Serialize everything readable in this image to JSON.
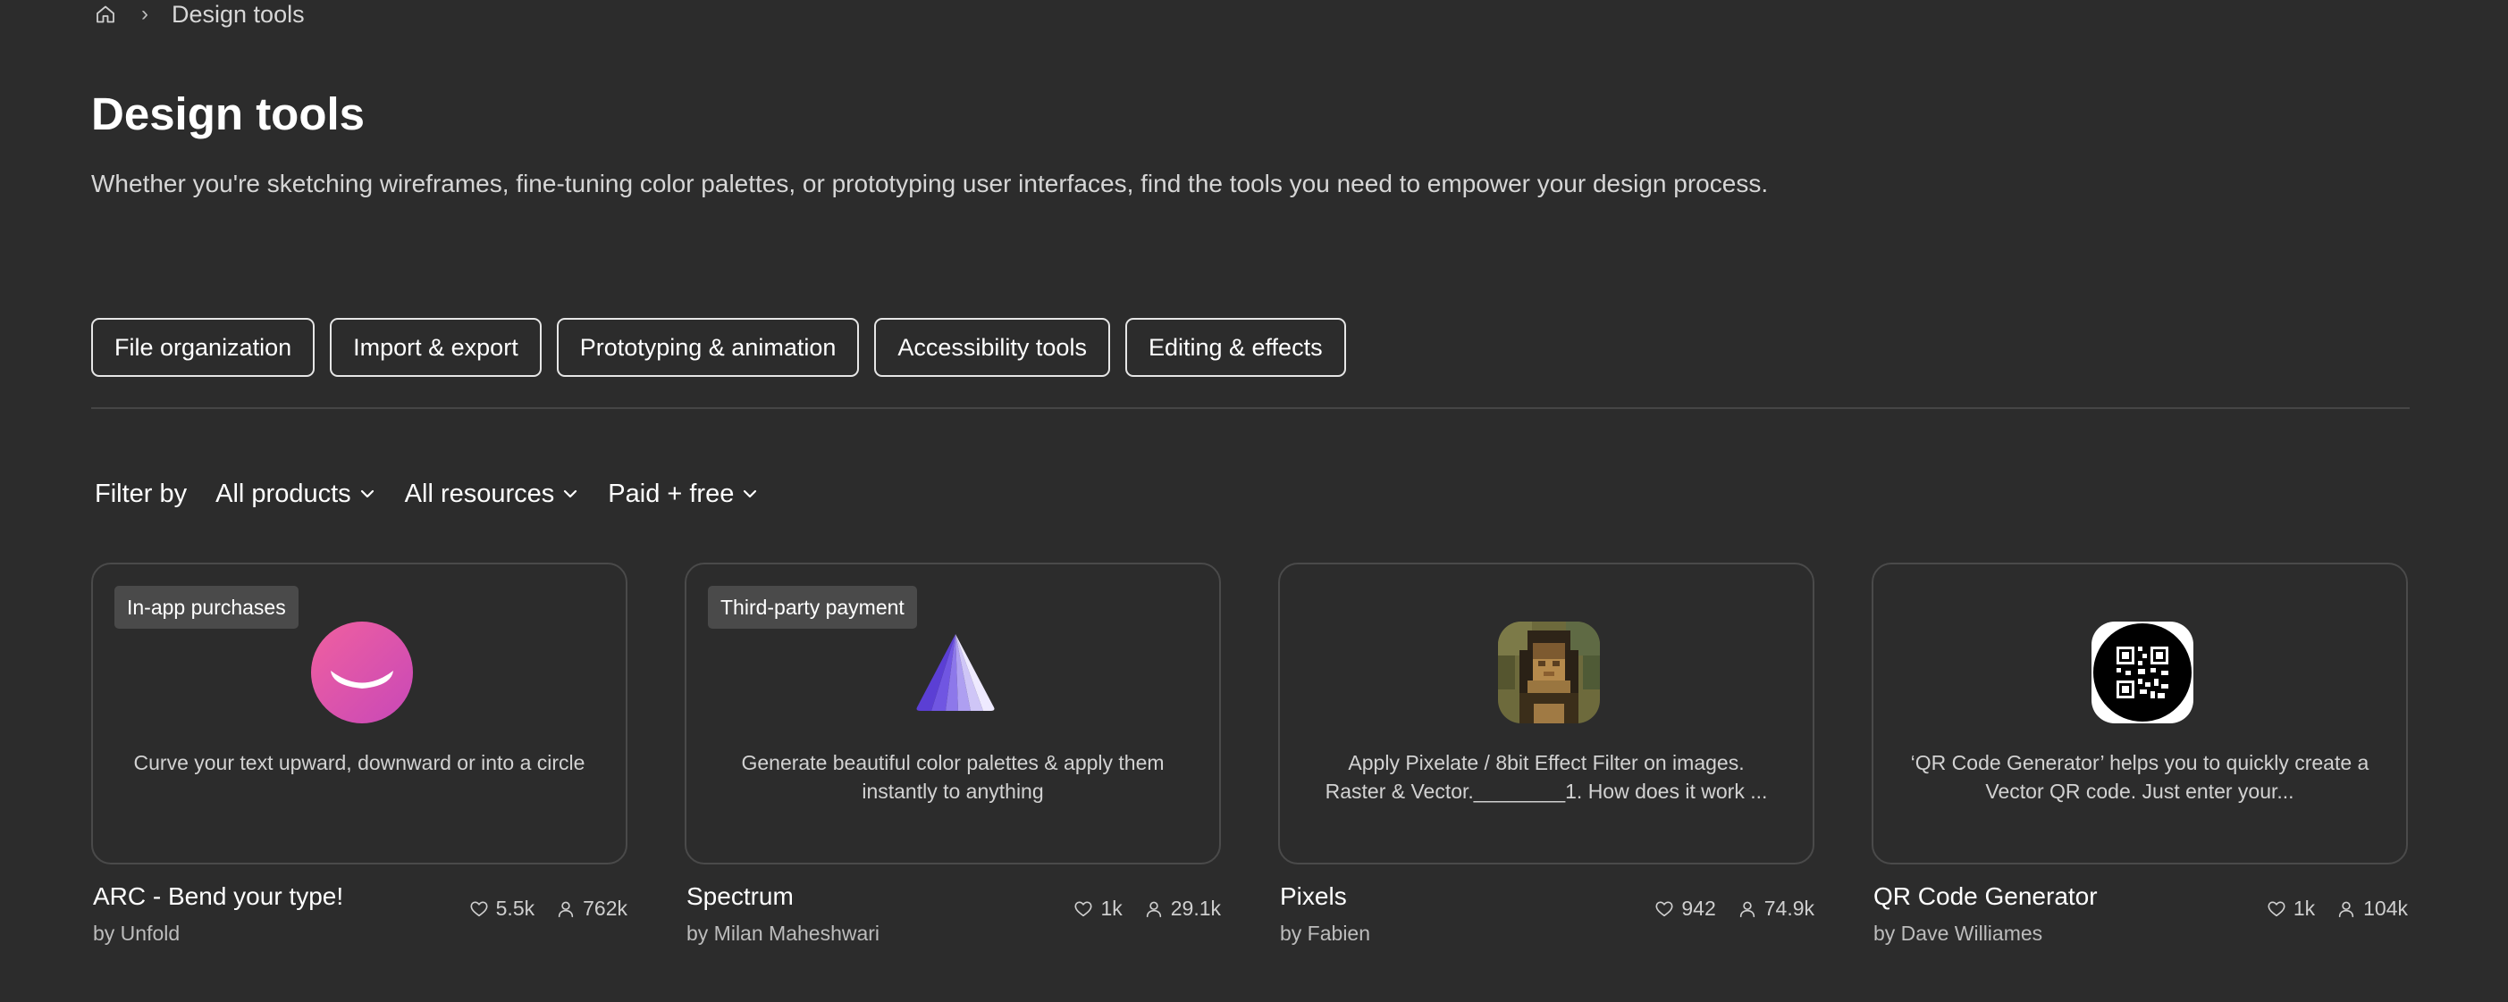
{
  "breadcrumb": {
    "home_icon": "home-icon",
    "separator": "›",
    "current": "Design tools"
  },
  "page": {
    "title": "Design tools",
    "description": "Whether you're sketching wireframes, fine-tuning color palettes, or prototyping user interfaces, find the tools you need to empower your design process."
  },
  "categories": [
    {
      "label": "File organization"
    },
    {
      "label": "Import & export"
    },
    {
      "label": "Prototyping & animation"
    },
    {
      "label": "Accessibility tools"
    },
    {
      "label": "Editing & effects"
    }
  ],
  "filters": {
    "label": "Filter by",
    "products": "All products",
    "resources": "All resources",
    "pricing": "Paid + free"
  },
  "cards": [
    {
      "badge": "In-app purchases",
      "description": "Curve your text upward, downward or into a circle",
      "title": "ARC - Bend your type!",
      "author": "by Unfold",
      "likes": "5.5k",
      "users": "762k",
      "icon": "arc-smile-icon"
    },
    {
      "badge": "Third-party payment",
      "description": "Generate beautiful color palettes & apply them instantly to anything",
      "title": "Spectrum",
      "author": "by Milan Maheshwari",
      "likes": "1k",
      "users": "29.1k",
      "icon": "spectrum-prism-icon"
    },
    {
      "badge": "",
      "description": "Apply Pixelate / 8bit Effect Filter on images. Raster & Vector.________1. How does it work ...",
      "title": "Pixels",
      "author": "by Fabien",
      "likes": "942",
      "users": "74.9k",
      "icon": "pixel-portrait-icon"
    },
    {
      "badge": "",
      "description": "‘QR Code Generator’ helps you to quickly create a Vector QR code. Just enter your...",
      "title": "QR Code Generator",
      "author": "by Dave Williames",
      "likes": "1k",
      "users": "104k",
      "icon": "qr-code-icon"
    }
  ],
  "colors": {
    "background": "#2c2c2c",
    "arc_pink": "#e0569c",
    "spectrum_purple": "#6b4be0"
  }
}
